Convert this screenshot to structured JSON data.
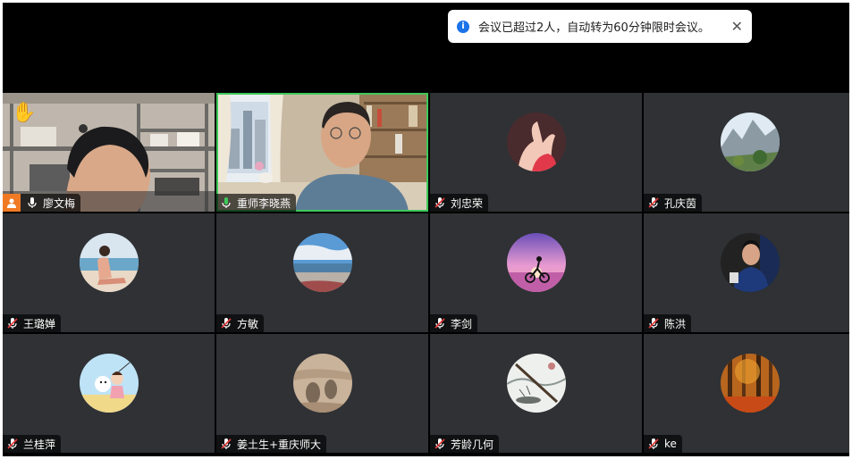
{
  "notification": {
    "message": "会议已超过2人，自动转为60分钟限时会议。",
    "icon": "info-icon",
    "close_icon": "close-icon"
  },
  "participants": [
    {
      "name": "廖文梅",
      "mic": "on",
      "video": true,
      "hand_raised": true,
      "pinned_icon": "user-icon"
    },
    {
      "name": "重师李晓燕",
      "mic": "speaking",
      "video": true,
      "active_speaker": true
    },
    {
      "name": "刘忠荣",
      "mic": "muted",
      "video": false
    },
    {
      "name": "孔庆茵",
      "mic": "muted",
      "video": false
    },
    {
      "name": "王璐婵",
      "mic": "muted",
      "video": false
    },
    {
      "name": "方敏",
      "mic": "muted",
      "video": false
    },
    {
      "name": "李剑",
      "mic": "muted",
      "video": false
    },
    {
      "name": "陈洪",
      "mic": "muted",
      "video": false
    },
    {
      "name": "兰桂萍",
      "mic": "muted",
      "video": false
    },
    {
      "name": "姜土生+重庆师大",
      "mic": "muted",
      "video": false
    },
    {
      "name": "芳龄几何",
      "mic": "muted",
      "video": false
    },
    {
      "name": "ke",
      "mic": "muted",
      "video": false
    }
  ],
  "colors": {
    "tile_bg": "#2f3135",
    "active_border": "#3ec95a",
    "muted_mic": "#e03b3b",
    "info": "#1a73e8",
    "user_badge": "#f07a23"
  }
}
